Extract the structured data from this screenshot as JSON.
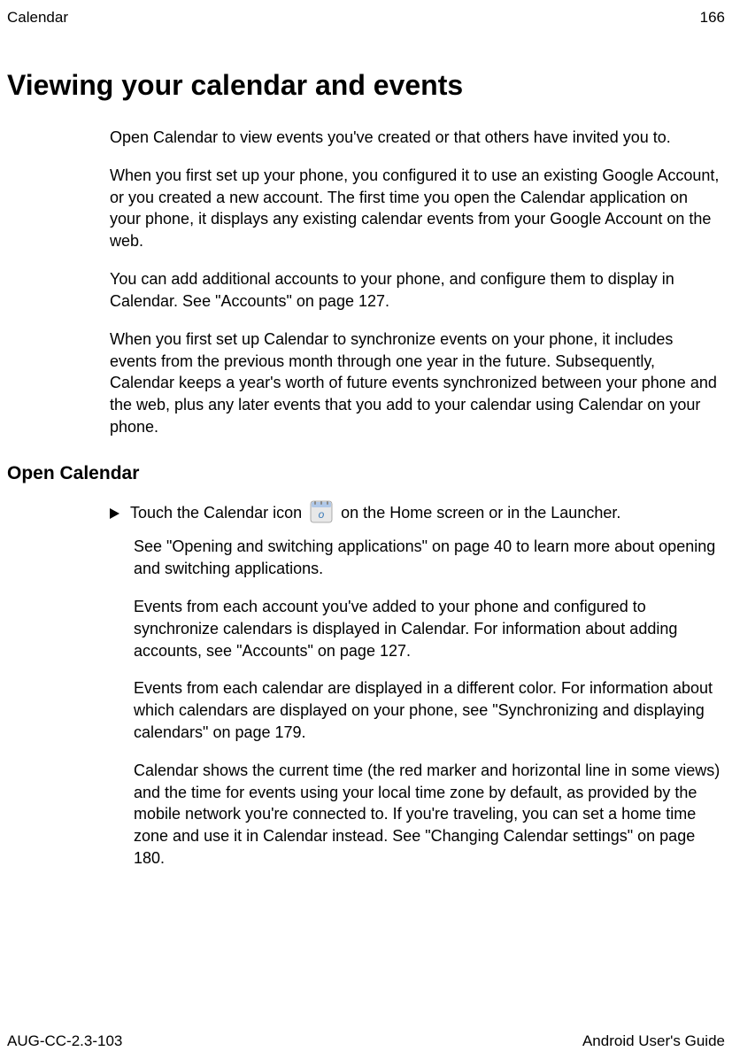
{
  "header": {
    "section": "Calendar",
    "page_number": "166"
  },
  "title": "Viewing your calendar and events",
  "intro": {
    "p1": "Open Calendar to view events you've created or that others have invited you to.",
    "p2": "When you first set up your phone, you configured it to use an existing Google Account, or you created a new account. The first time you open the Calendar application on your phone, it displays any existing calendar events from your Google Account on the web.",
    "p3": "You can add additional accounts to your phone, and configure them to display in Calendar. See \"Accounts\" on page 127.",
    "p4": "When you first set up Calendar to synchronize events on your phone, it includes events from the previous month through one year in the future. Subsequently, Calendar keeps a year's worth of future events synchronized between your phone and the web, plus any later events that you add to your calendar using Calendar on your phone."
  },
  "open_calendar": {
    "heading": "Open Calendar",
    "bullet_prefix": "Touch the Calendar icon",
    "bullet_suffix": "on the Home screen or in the Launcher.",
    "p1": "See \"Opening and switching applications\" on page 40 to learn more about opening and switching applications.",
    "p2": "Events from each account you've added to your phone and configured to synchronize calendars is displayed in Calendar. For information about adding accounts, see \"Accounts\" on page 127.",
    "p3": "Events from each calendar are displayed in a different color. For information about which calendars are displayed on your phone, see \"Synchronizing and displaying calendars\" on page 179.",
    "p4": "Calendar shows the current time (the red marker and horizontal line in some views) and the time for events using your local time zone by default, as provided by the mobile network you're connected to. If you're traveling, you can set a home time zone and use it in Calendar instead. See \"Changing Calendar settings\" on page 180."
  },
  "footer": {
    "doc_id": "AUG-CC-2.3-103",
    "guide": "Android User's Guide"
  }
}
